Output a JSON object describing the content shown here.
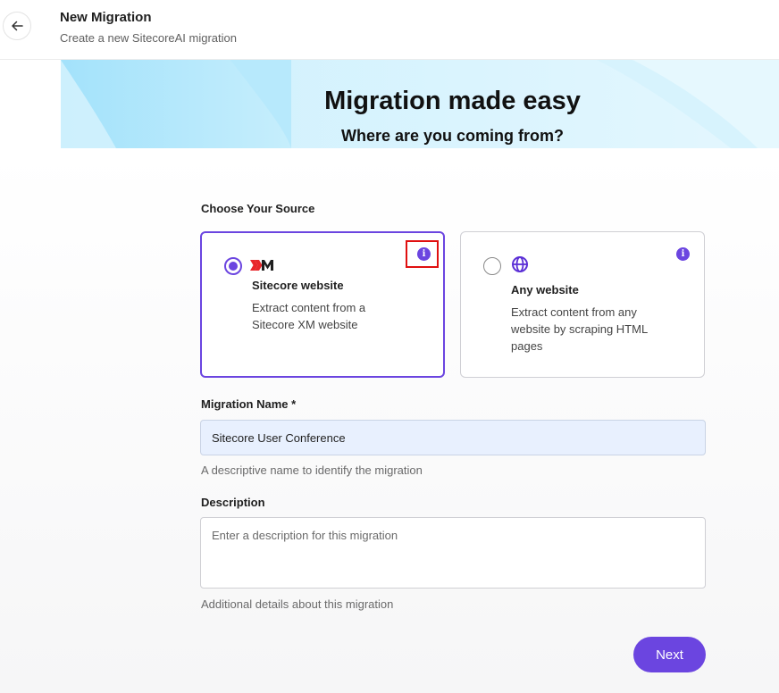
{
  "header": {
    "back_icon": "arrow-left-icon",
    "title": "New Migration",
    "subtitle": "Create a new SitecoreAI migration"
  },
  "hero": {
    "title": "Migration made easy",
    "subtitle": "Where are you coming from?"
  },
  "source": {
    "label": "Choose Your Source",
    "options": [
      {
        "logo": "XM",
        "title": "Sitecore website",
        "description": "Extract content from a Sitecore XM website",
        "selected": true,
        "icon": "sitecore-xm-logo",
        "info_icon": "i"
      },
      {
        "title": "Any website",
        "description": "Extract content from any website by scraping HTML pages",
        "selected": false,
        "icon": "globe-icon",
        "info_icon": "i"
      }
    ]
  },
  "migration_name": {
    "label": "Migration Name *",
    "value": "Sitecore User Conference",
    "helper": "A descriptive name to identify the migration"
  },
  "description": {
    "label": "Description",
    "placeholder": "Enter a description for this migration",
    "value": "",
    "helper": "Additional details about this migration"
  },
  "actions": {
    "next_label": "Next"
  },
  "colors": {
    "accent": "#6b45e0",
    "highlight": "#e01010",
    "input_fill": "#e8f0fe"
  }
}
